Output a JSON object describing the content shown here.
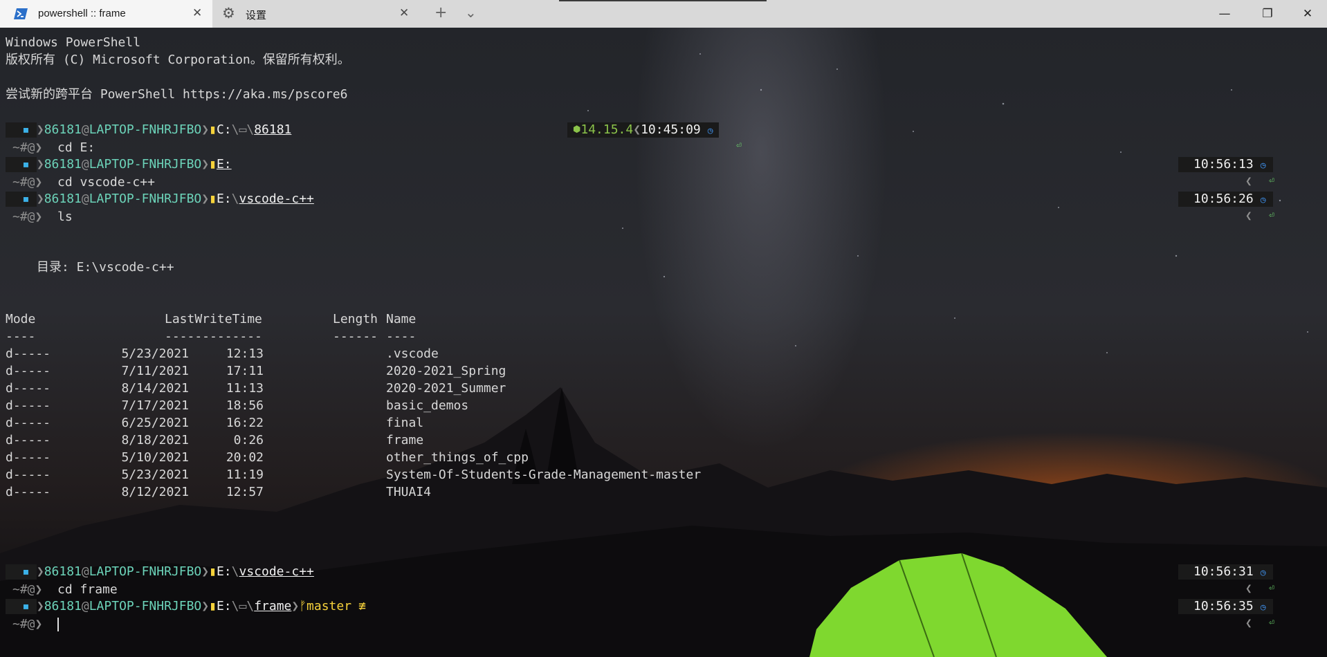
{
  "titlebar": {
    "tab_powershell": "powershell :: frame",
    "tab_settings": "设置",
    "new_tab": "+",
    "dropdown": "⌄",
    "minimize": "—",
    "restore": "❐",
    "close": "✕"
  },
  "terminal": {
    "banner1": "Windows PowerShell",
    "banner2": "版权所有 (C) Microsoft Corporation。保留所有权利。",
    "banner3": "尝试新的跨平台 PowerShell https://aka.ms/pscore6",
    "user": "86181",
    "host": "LAPTOP-FNHRJFBO",
    "at": "@",
    "mini_prompt": "~#@",
    "node_version": "14.15.4",
    "first_time": "10:45:09",
    "drive_c": "C:",
    "home_dir": "86181",
    "drive_e": "E:",
    "dir_vscode": "vscode-c++",
    "dir_frame": "frame",
    "git_branch": "master",
    "git_status": "≢",
    "cmd1": "cd E:",
    "cmd2": "cd vscode-c++",
    "cmd3": "ls",
    "cmd4": "cd frame",
    "times": [
      "10:56:13",
      "10:56:26",
      "10:56:31",
      "10:56:35"
    ],
    "directory_label": "目录: E:\\vscode-c++",
    "headers": {
      "mode": "Mode",
      "lwt": "LastWriteTime",
      "length": "Length",
      "name": "Name"
    },
    "underlines": {
      "mode": "----",
      "lwt": "-------------",
      "length": "------",
      "name": "----"
    },
    "rows": [
      {
        "mode": "d-----",
        "date": "5/23/2021",
        "time": "12:13",
        "name": ".vscode"
      },
      {
        "mode": "d-----",
        "date": "7/11/2021",
        "time": "17:11",
        "name": "2020-2021_Spring"
      },
      {
        "mode": "d-----",
        "date": "8/14/2021",
        "time": "11:13",
        "name": "2020-2021_Summer"
      },
      {
        "mode": "d-----",
        "date": "7/17/2021",
        "time": "18:56",
        "name": "basic_demos"
      },
      {
        "mode": "d-----",
        "date": "6/25/2021",
        "time": "16:22",
        "name": "final"
      },
      {
        "mode": "d-----",
        "date": "8/18/2021",
        "time": "0:26",
        "name": "frame"
      },
      {
        "mode": "d-----",
        "date": "5/10/2021",
        "time": "20:02",
        "name": "other_things_of_cpp"
      },
      {
        "mode": "d-----",
        "date": "5/23/2021",
        "time": "11:19",
        "name": "System-Of-Students-Grade-Management-master"
      },
      {
        "mode": "d-----",
        "date": "8/12/2021",
        "time": "12:57",
        "name": "THUAI4"
      }
    ]
  },
  "colors": {
    "accent_green": "#6cd3b9",
    "folder_yellow": "#f6d23b",
    "clock_blue": "#3e8ee8",
    "node_green": "#8bc34a"
  }
}
